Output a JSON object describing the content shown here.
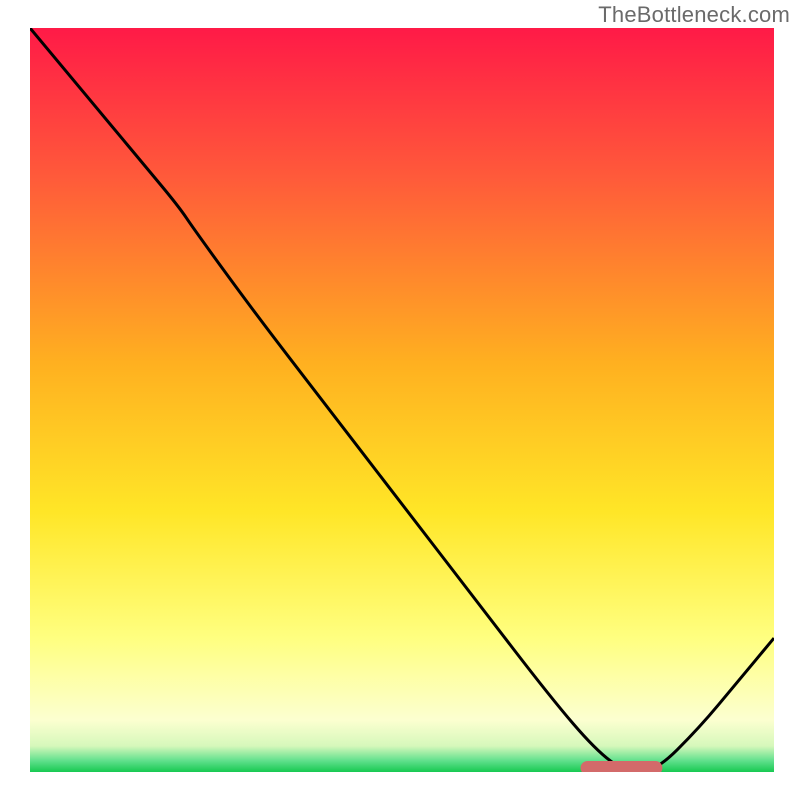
{
  "watermark": "TheBottleneck.com",
  "chart_data": {
    "type": "line",
    "title": "",
    "xlabel": "",
    "ylabel": "",
    "xlim": [
      0,
      100
    ],
    "ylim": [
      0,
      100
    ],
    "grid": false,
    "legend": false,
    "axes_visible": false,
    "description": "Single black curve on a vertical rainbow gradient background (red top → orange → yellow → pale yellow → thin green band at bottom). Curve starts at top-left, bends around x≈22, descends roughly linearly to a minimum near x≈80 at y≈0, then rises toward the right edge.",
    "x": [
      0,
      5,
      10,
      15,
      20,
      22,
      30,
      40,
      50,
      60,
      70,
      76,
      80,
      84,
      90,
      95,
      100
    ],
    "values": [
      100,
      94,
      88,
      82,
      76,
      73,
      62,
      49,
      36,
      23,
      10,
      3,
      0,
      0,
      6,
      12,
      18
    ],
    "optimum_marker": {
      "x_start": 74,
      "x_end": 85,
      "y": 0,
      "color": "#d36a6a"
    },
    "gradient_stops": [
      {
        "pos": 0.0,
        "color": "#ff1a47"
      },
      {
        "pos": 0.2,
        "color": "#ff5a3a"
      },
      {
        "pos": 0.45,
        "color": "#ffb020"
      },
      {
        "pos": 0.65,
        "color": "#ffe627"
      },
      {
        "pos": 0.82,
        "color": "#ffff80"
      },
      {
        "pos": 0.93,
        "color": "#fcffd0"
      },
      {
        "pos": 0.965,
        "color": "#d6f8bb"
      },
      {
        "pos": 0.985,
        "color": "#5fe08c"
      },
      {
        "pos": 1.0,
        "color": "#17c951"
      }
    ]
  }
}
